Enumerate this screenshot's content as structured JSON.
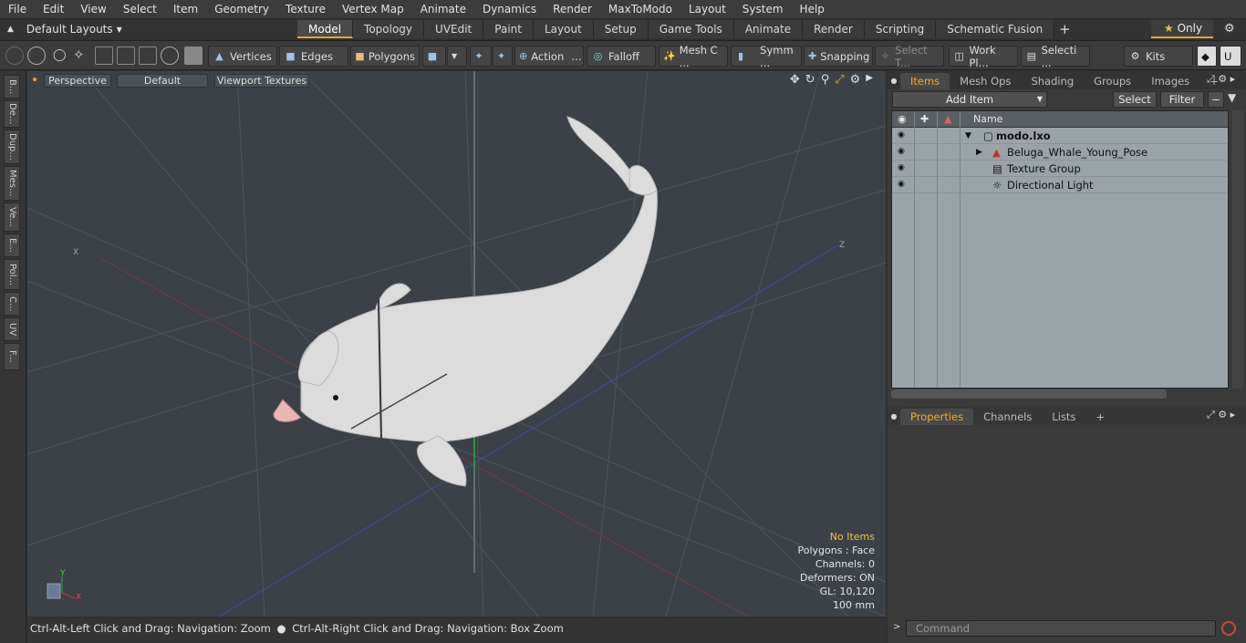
{
  "menu": [
    "File",
    "Edit",
    "View",
    "Select",
    "Item",
    "Geometry",
    "Texture",
    "Vertex Map",
    "Animate",
    "Dynamics",
    "Render",
    "MaxToModo",
    "Layout",
    "System",
    "Help"
  ],
  "layouts": {
    "label": "Default Layouts"
  },
  "mode_tabs": [
    "Model",
    "Topology",
    "UVEdit",
    "Paint",
    "Layout",
    "Setup",
    "Game Tools",
    "Animate",
    "Render",
    "Scripting",
    "Schematic Fusion"
  ],
  "only_label": "Only",
  "toolbar": {
    "vertices": "Vertices",
    "edges": "Edges",
    "polygons": "Polygons",
    "action": "Action",
    "falloff": "Falloff",
    "mesh": "Mesh C ...",
    "symmetry": "Symm ...",
    "snapping": "Snapping",
    "select_t": "Select T...",
    "workplane": "Work Pl...",
    "selection": "Selecti ...",
    "kits": "Kits"
  },
  "left_tabs": [
    "B...",
    "De...",
    "Dup...",
    "Mes...",
    "Ve...",
    "E...",
    "Pol...",
    "C...",
    "UV",
    "F..."
  ],
  "viewport": {
    "view": "Perspective",
    "shading": "Default",
    "textures": "Viewport Textures",
    "axis_x": "X",
    "axis_z": "Z",
    "gizmo_y": "Y",
    "gizmo_x": "X"
  },
  "info": {
    "items": "No Items",
    "polygons": "Polygons : Face",
    "channels": "Channels: 0",
    "deformers": "Deformers: ON",
    "gl": "GL: 10,120",
    "scale": "100 mm"
  },
  "status": {
    "left": "Ctrl-Alt-Left Click and Drag: Navigation: Zoom",
    "right": "Ctrl-Alt-Right Click and Drag: Navigation: Box Zoom"
  },
  "item_tabs": [
    "Items",
    "Mesh Ops",
    "Shading",
    "Groups",
    "Images"
  ],
  "item_buttons": {
    "add": "Add Item",
    "select": "Select",
    "filter": "Filter"
  },
  "list_header": "Name",
  "items": [
    {
      "name": "modo.lxo",
      "bold": true,
      "indent": 0
    },
    {
      "name": "Beluga_Whale_Young_Pose",
      "indent": 1
    },
    {
      "name": "Texture Group",
      "indent": 1
    },
    {
      "name": "Directional Light",
      "indent": 1
    }
  ],
  "prop_tabs": [
    "Properties",
    "Channels",
    "Lists"
  ],
  "command": {
    "placeholder": "Command"
  },
  "colors": {
    "accent": "#e6a23c",
    "viewport": "#3b4146",
    "list": "#9aa3a8"
  }
}
